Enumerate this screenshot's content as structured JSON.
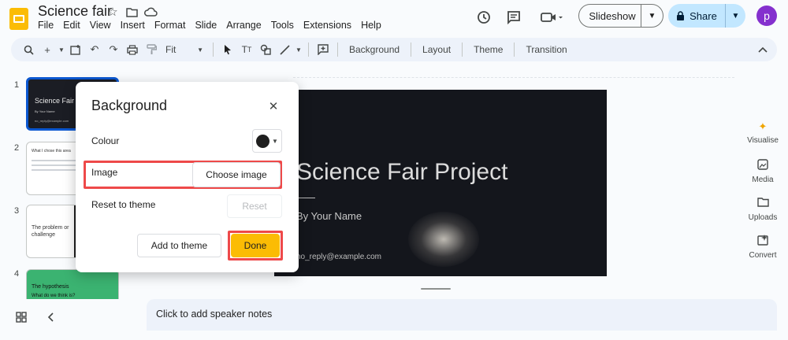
{
  "app": {
    "doc_title": "Science fair",
    "menu": [
      "File",
      "Edit",
      "View",
      "Insert",
      "Format",
      "Slide",
      "Arrange",
      "Tools",
      "Extensions",
      "Help"
    ],
    "slideshow_label": "Slideshow",
    "share_label": "Share",
    "avatar_letter": "p"
  },
  "toolbar": {
    "zoom": "Fit",
    "background": "Background",
    "layout": "Layout",
    "theme": "Theme",
    "transition": "Transition"
  },
  "filmstrip": [
    {
      "num": "1",
      "title": "Science Fair",
      "subtitle": "By Your Name",
      "email": "no_reply@example.com"
    },
    {
      "num": "2",
      "title": "What I chose this area"
    },
    {
      "num": "3",
      "title": "The problem or challenge"
    },
    {
      "num": "4",
      "title": "The hypothesis",
      "subtitle": "What do we think is?"
    }
  ],
  "slide": {
    "title": "Science Fair Project",
    "subtitle": "By Your Name",
    "email": "no_reply@example.com"
  },
  "side_panel": {
    "visualise": "Visualise",
    "media": "Media",
    "uploads": "Uploads",
    "convert": "Convert"
  },
  "notes_placeholder": "Click to add speaker notes",
  "dialog": {
    "title": "Background",
    "colour_label": "Colour",
    "colour_value": "#1f1f1f",
    "image_label": "Image",
    "choose_image": "Choose image",
    "reset_label": "Reset to theme",
    "reset_button": "Reset",
    "add_to_theme": "Add to theme",
    "done": "Done"
  },
  "colors": {
    "accent": "#0b57d0",
    "share_bg": "#c2e7ff",
    "done_bg": "#fbbc04",
    "highlight": "#ee4949",
    "thumb4_bg": "#3bb371"
  }
}
